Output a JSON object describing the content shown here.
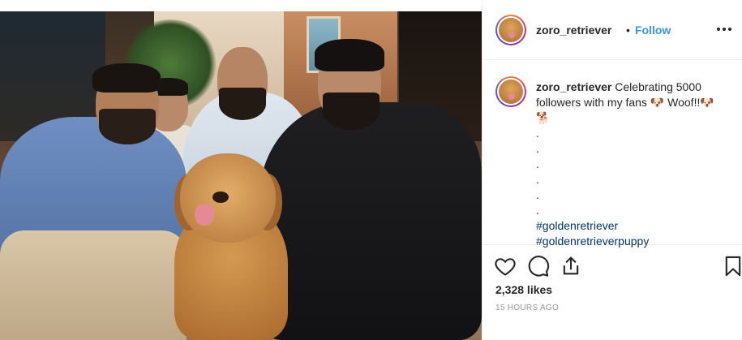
{
  "post": {
    "username": "zoro_retriever",
    "follow_label": "Follow",
    "separator": "•",
    "caption_lines": [
      "Celebrating 5000",
      "followers with my fans 🐶 Woof!!🐶",
      "🐕"
    ],
    "caption_dots": [
      ".",
      ".",
      ".",
      ".",
      ".",
      "."
    ],
    "hashtags": [
      "#goldenretriever",
      "#goldenretrieverpuppy"
    ],
    "likes_text": "2,328 likes",
    "timestamp": "15 HOURS AGO"
  },
  "icons": {
    "more": "more-options-icon",
    "like": "heart-icon",
    "comment": "comment-bubble-icon",
    "share": "share-icon",
    "save": "bookmark-icon"
  },
  "colors": {
    "link_blue": "#3897f0",
    "hashtag_blue": "#003569",
    "muted": "#999999",
    "text": "#262626"
  }
}
